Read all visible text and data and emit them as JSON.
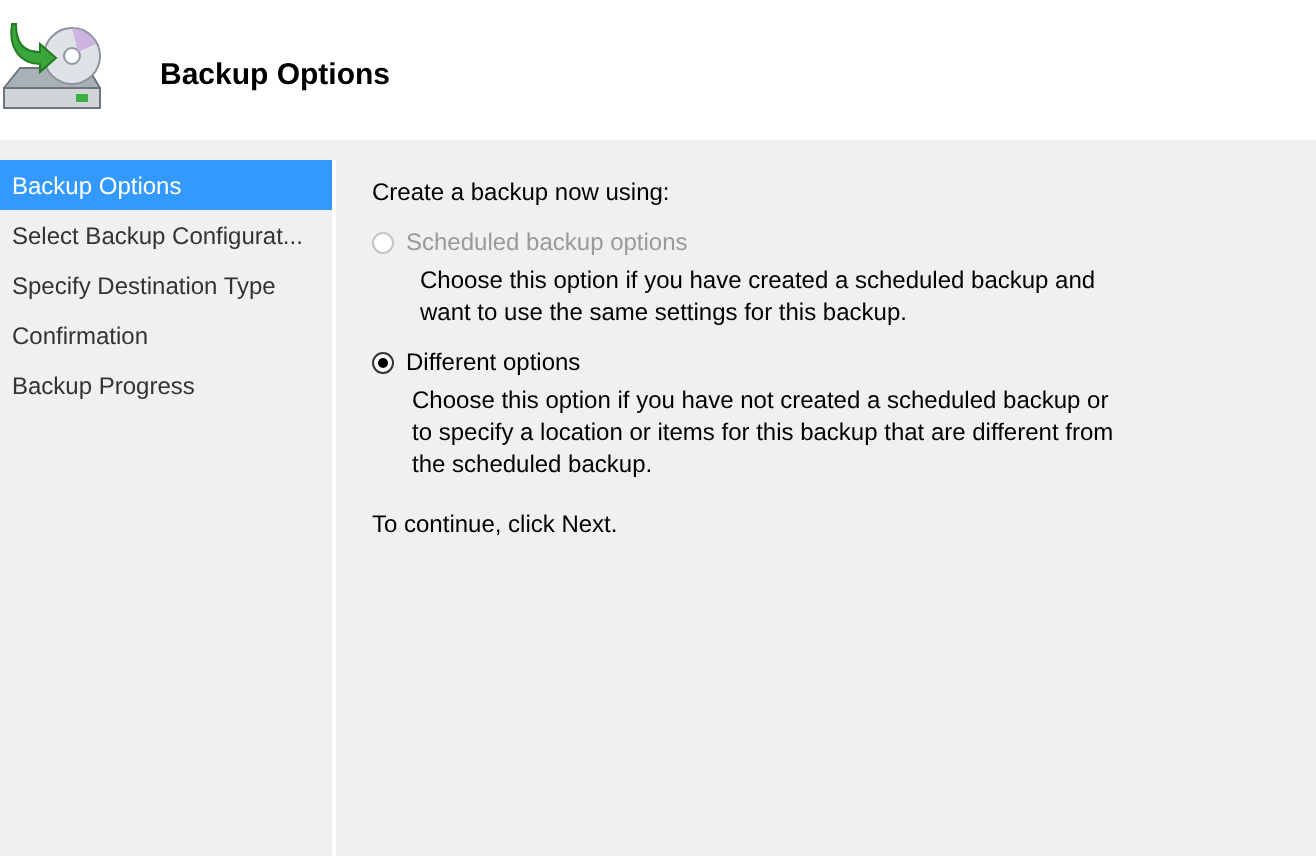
{
  "header": {
    "title": "Backup Options"
  },
  "sidebar": {
    "items": [
      {
        "label": "Backup Options",
        "selected": true
      },
      {
        "label": "Select Backup Configurat...",
        "selected": false
      },
      {
        "label": "Specify Destination Type",
        "selected": false
      },
      {
        "label": "Confirmation",
        "selected": false
      },
      {
        "label": "Backup Progress",
        "selected": false
      }
    ]
  },
  "content": {
    "prompt": "Create a backup now using:",
    "options": [
      {
        "label": "Scheduled backup options",
        "selected": false,
        "disabled": true,
        "description": "Choose this option if you have created a scheduled backup and want to use the same settings for this backup."
      },
      {
        "label": "Different options",
        "selected": true,
        "disabled": false,
        "description": "Choose this option if you have not created a scheduled backup or to specify a location or items for this backup that are different from the scheduled backup."
      }
    ],
    "footer": "To continue, click Next."
  }
}
